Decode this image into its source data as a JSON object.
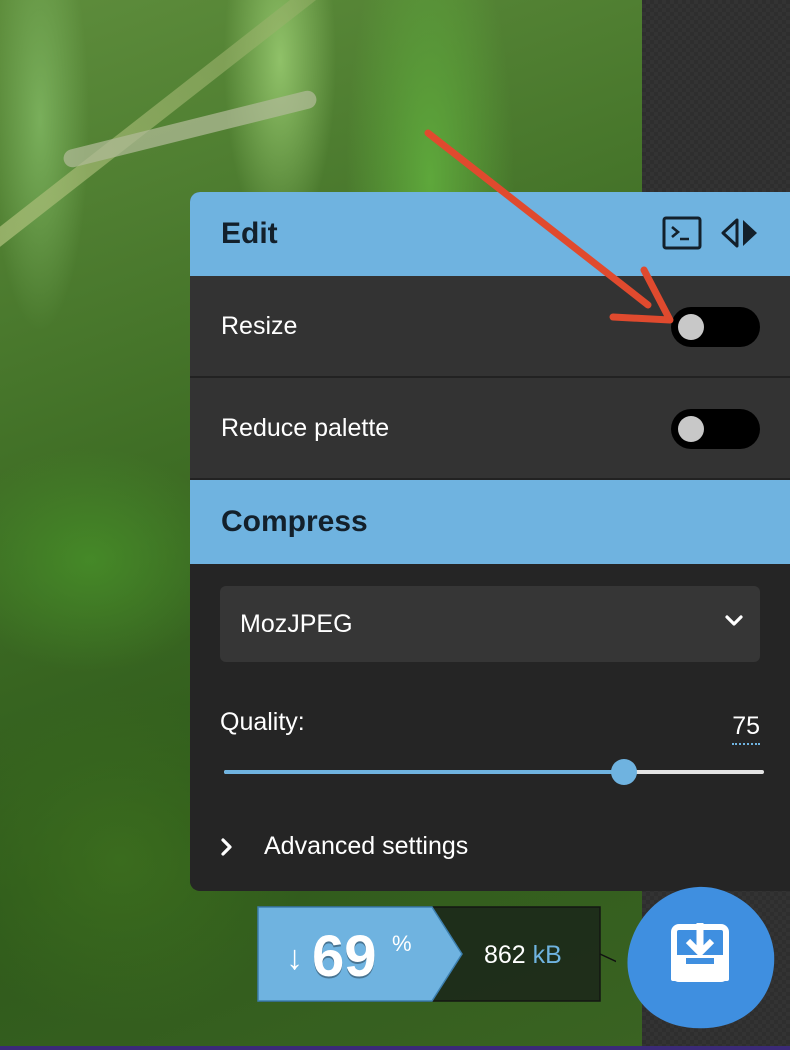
{
  "edit": {
    "title": "Edit",
    "options": [
      {
        "label": "Resize",
        "enabled": false
      },
      {
        "label": "Reduce palette",
        "enabled": false
      }
    ],
    "tools": [
      "terminal-icon",
      "toggle-sides-icon"
    ]
  },
  "compress": {
    "title": "Compress",
    "codec": "MozJPEG",
    "quality_label": "Quality:",
    "quality_value": "75",
    "quality_fraction": 0.74,
    "advanced_label": "Advanced settings"
  },
  "results": {
    "arrow": "↓",
    "savings_number": "69",
    "savings_unit": "%",
    "size_value": "862",
    "size_unit": "kB"
  },
  "colors": {
    "accent": "#6fb3e0",
    "panel": "#252525",
    "row": "#333333",
    "download": "#3f8fe0",
    "annotation_arrow": "#e04a2e"
  }
}
